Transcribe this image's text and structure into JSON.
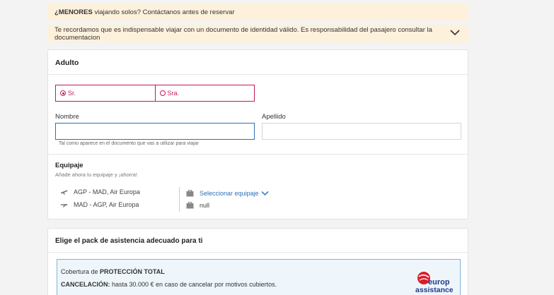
{
  "banners": {
    "minors_bold": "¿MENORES",
    "minors_rest": " viajando solos? Contáctanos antes de reservar",
    "id_notice": "Te recordamos que es indispensable viajar con un documento de identidad válido. Es responsabilidad del pasajero consultar la documentacion"
  },
  "passenger": {
    "title": "Adulto",
    "salutation_options": [
      "Sr.",
      "Sra."
    ],
    "selected_salutation": "Sr.",
    "first_name_label": "Nombre",
    "first_name_value": "",
    "first_name_hint": "Tal como aparece en el documento que vas a utilizar para viajar",
    "last_name_label": "Apellido",
    "last_name_value": ""
  },
  "baggage": {
    "title": "Equipaje",
    "subtitle": "Añade ahora tu equipaje y ¡ahorra!",
    "flights": [
      {
        "route": "AGP - MAD, Air Europa",
        "icon": "plane-takeoff-icon"
      },
      {
        "route": "MAD - AGP, Air Europa",
        "icon": "plane-landing-icon"
      }
    ],
    "select_label": "Seleccionar equipaje",
    "second_value": "null"
  },
  "assistance": {
    "title": "Elige el pack de asistencia adecuado para ti",
    "coverage_prefix": "Cobertura de ",
    "coverage_bold": "PROTECCIÓN TOTAL",
    "cancel_bold": "CANCELACIÓN:",
    "cancel_text": " hasta 30.000 € en caso de cancelar por motivos cubiertos.",
    "logo_line1": "europ",
    "logo_line2": "assistance"
  },
  "colors": {
    "banner_bg": "#fdf1dc",
    "accent_magenta": "#c2185b",
    "link_blue": "#2f6fb5",
    "insurance_bg": "#eef6fb",
    "logo_red": "#d81e2c",
    "logo_navy": "#1d3b8b"
  }
}
